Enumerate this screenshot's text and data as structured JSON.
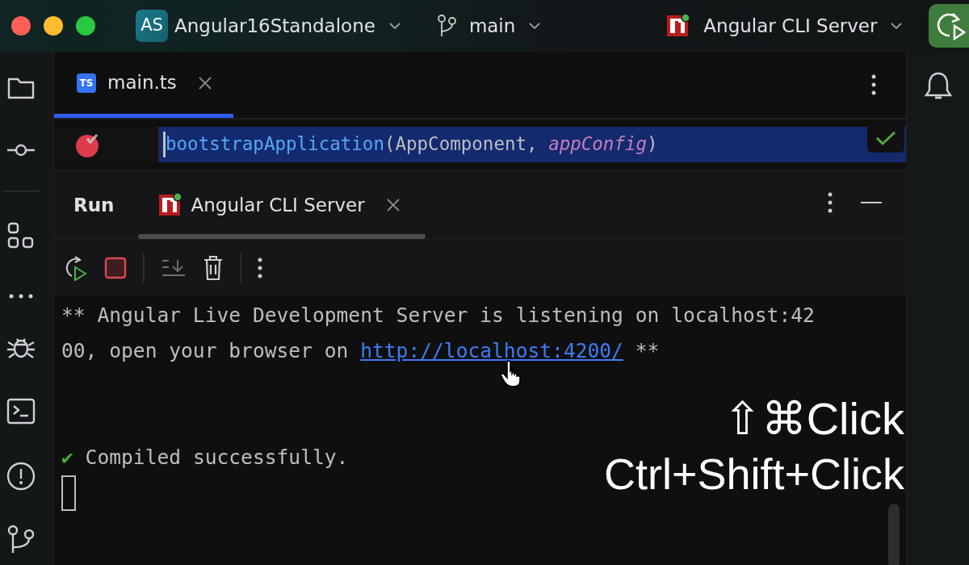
{
  "window": {
    "traffic_lights": [
      {
        "color": "#ff5f57"
      },
      {
        "color": "#febc2e"
      },
      {
        "color": "#28c840"
      }
    ]
  },
  "title_bar": {
    "project_badge": "AS",
    "project": "Angular16Standalone",
    "branch": "main",
    "run_config": "Angular CLI Server"
  },
  "editor": {
    "tabs": [
      {
        "label": "main.ts",
        "file_badge": "TS",
        "selected": true
      }
    ],
    "line": {
      "tokens": [
        {
          "text": "bootstrapApplication",
          "kind": "function"
        },
        {
          "text": "(AppComponent, ",
          "kind": "plain"
        },
        {
          "text": "appConfig",
          "kind": "param"
        },
        {
          "text": ")",
          "kind": "plain"
        }
      ]
    }
  },
  "run_panel": {
    "title": "Run",
    "tabs": [
      {
        "label": "Angular CLI Server",
        "selected": true
      }
    ],
    "console": [
      {
        "kind": "message",
        "text": "** Angular Live Development Server is listening on localhost:4200, open your browser on ",
        "link": "http://localhost:4200/",
        "suffix": " **"
      },
      {
        "kind": "success",
        "mark": "✔",
        "text": "Compiled successfully."
      }
    ]
  },
  "overlay": {
    "mac_shortcut": "⇧⌘Click",
    "shortcut": "Ctrl+Shift+Click"
  }
}
